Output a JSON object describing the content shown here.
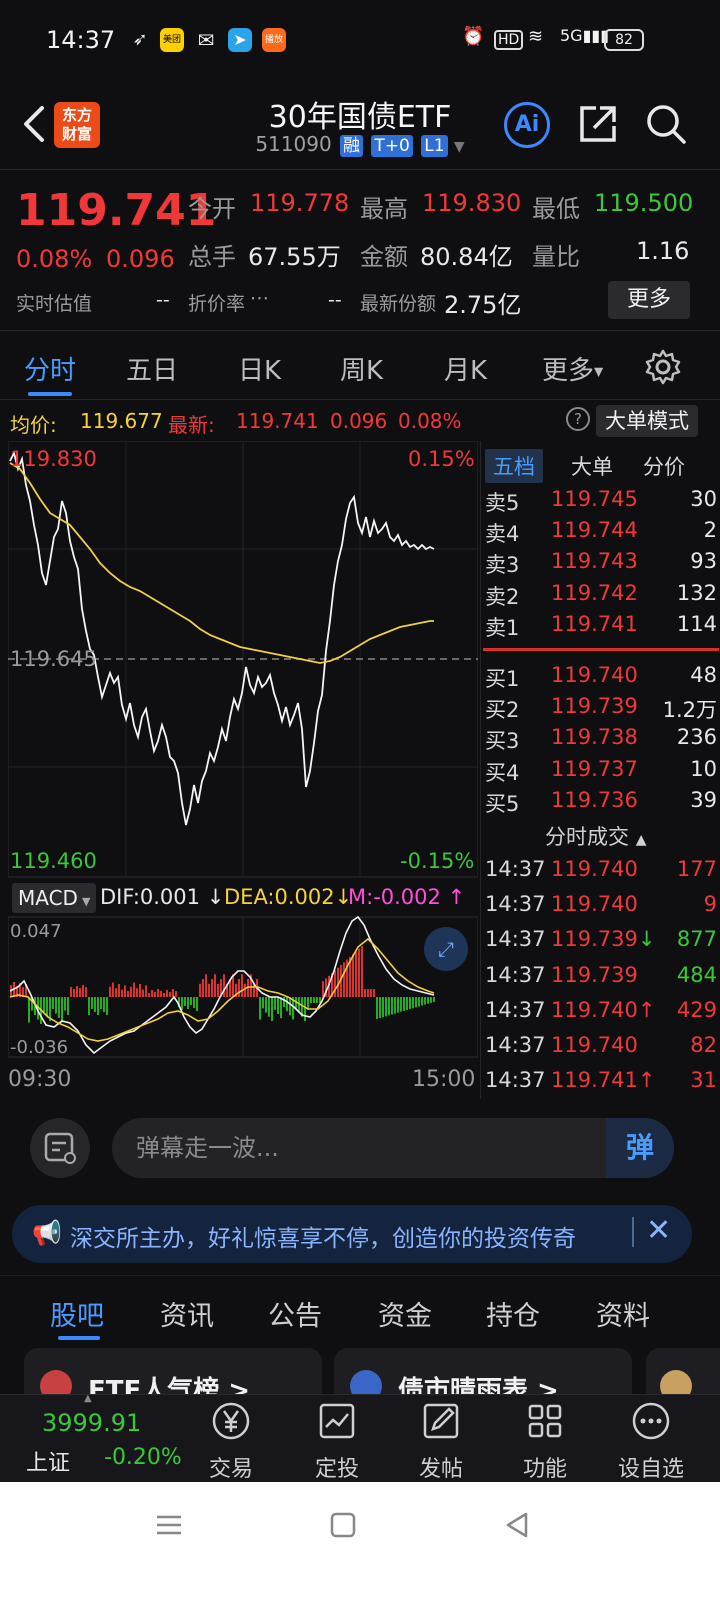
{
  "status_bar": {
    "time": "14:37",
    "apps": [
      "meituan-icon",
      "wechat-icon",
      "telegram-icon",
      "app-icon"
    ],
    "battery": "82"
  },
  "header": {
    "logo_line1": "东方",
    "logo_line2": "财富",
    "title": "30年国债ETF",
    "code": "511090",
    "tags": [
      "融",
      "T+0",
      "L1"
    ],
    "ai_label": "Ai"
  },
  "quote": {
    "price": "119.741",
    "change_pct": "0.08%",
    "change": "0.096",
    "open_label": "今开",
    "open": "119.778",
    "high_label": "最高",
    "high": "119.830",
    "low_label": "最低",
    "low": "119.500",
    "volume_label": "总手",
    "volume": "67.55万",
    "amount_label": "金额",
    "amount": "80.84亿",
    "ratio_label": "量比",
    "ratio": "1.16",
    "est_label": "实时估值",
    "est_value": "--",
    "discount_label": "折价率",
    "discount_value": "--",
    "shares_label": "最新份额",
    "shares_value": "2.75亿",
    "more_label": "更多"
  },
  "tabs": {
    "items": [
      "分时",
      "五日",
      "日K",
      "周K",
      "月K",
      "更多"
    ],
    "active": 0
  },
  "avg_bar": {
    "avg_label": "均价:",
    "avg_value": "119.677",
    "latest_label": "最新:",
    "latest_value": "119.741",
    "latest_change": "0.096",
    "latest_pct": "0.08%",
    "mode_label": "大单模式"
  },
  "chart": {
    "top_price": "119.830",
    "top_pct": "0.15%",
    "mid_price": "119.645",
    "bottom_price": "119.460",
    "bottom_pct": "-0.15%",
    "macd_label": "MACD",
    "dif": "DIF:0.001",
    "dea": "DEA:0.002",
    "m": "M:-0.002",
    "macd_top": "0.047",
    "macd_bottom": "-0.036",
    "time_start": "09:30",
    "time_end": "15:00",
    "colors": {
      "price_line": "#ffffff",
      "avg_line": "#f5d23a",
      "up": "#e03030",
      "down": "#20b020"
    }
  },
  "order_book": {
    "tabs": [
      "五档",
      "大单",
      "分价"
    ],
    "asks": [
      {
        "label": "卖5",
        "price": "119.745",
        "vol": "30"
      },
      {
        "label": "卖4",
        "price": "119.744",
        "vol": "2"
      },
      {
        "label": "卖3",
        "price": "119.743",
        "vol": "93"
      },
      {
        "label": "卖2",
        "price": "119.742",
        "vol": "132"
      },
      {
        "label": "卖1",
        "price": "119.741",
        "vol": "114"
      }
    ],
    "bids": [
      {
        "label": "买1",
        "price": "119.740",
        "vol": "48"
      },
      {
        "label": "买2",
        "price": "119.739",
        "vol": "1.2万"
      },
      {
        "label": "买3",
        "price": "119.738",
        "vol": "236"
      },
      {
        "label": "买4",
        "price": "119.737",
        "vol": "10"
      },
      {
        "label": "买5",
        "price": "119.736",
        "vol": "39"
      }
    ],
    "trades_title": "分时成交",
    "trades": [
      {
        "time": "14:37",
        "price": "119.740",
        "arrow": "",
        "vol": "177",
        "color": "red"
      },
      {
        "time": "14:37",
        "price": "119.740",
        "arrow": "",
        "vol": "9",
        "color": "red"
      },
      {
        "time": "14:37",
        "price": "119.739",
        "arrow": "↓",
        "vol": "877",
        "color": "green"
      },
      {
        "time": "14:37",
        "price": "119.739",
        "arrow": "",
        "vol": "484",
        "color": "green"
      },
      {
        "time": "14:37",
        "price": "119.740",
        "arrow": "↑",
        "vol": "429",
        "color": "red"
      },
      {
        "time": "14:37",
        "price": "119.740",
        "arrow": "",
        "vol": "82",
        "color": "red"
      },
      {
        "time": "14:37",
        "price": "119.741",
        "arrow": "↑",
        "vol": "31",
        "color": "red"
      }
    ]
  },
  "comment_bar": {
    "placeholder": "弹幕走一波...",
    "danmu_label": "弹"
  },
  "banner": {
    "text": "深交所主办，好礼惊喜享不停，创造你的投资传奇"
  },
  "section_tabs": {
    "items": [
      "股吧",
      "资讯",
      "公告",
      "资金",
      "持仓",
      "资料"
    ],
    "active": 0
  },
  "cards": [
    {
      "title": "ETF人气榜 >"
    },
    {
      "title": "债市晴雨表 >"
    }
  ],
  "bottom_nav": {
    "index_value": "3999.91",
    "index_name": "上证",
    "index_pct": "-0.20%",
    "items": [
      "交易",
      "定投",
      "发帖",
      "功能",
      "设自选"
    ]
  }
}
